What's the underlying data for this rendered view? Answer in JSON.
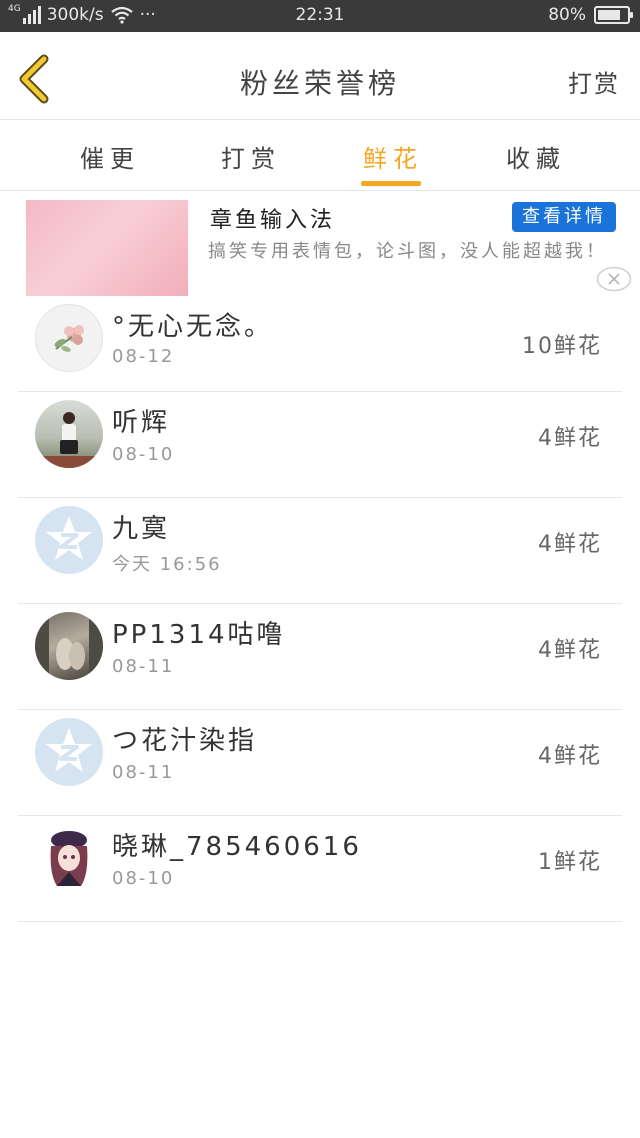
{
  "status_bar": {
    "network": "4G",
    "speed": "300k/s",
    "dots": "···",
    "time": "22:31",
    "battery": "80%",
    "battery_level": 0.8
  },
  "header": {
    "title": "粉丝荣誉榜",
    "action": "打赏"
  },
  "tabs": [
    {
      "label": "催更",
      "active": false
    },
    {
      "label": "打赏",
      "active": false
    },
    {
      "label": "鲜花",
      "active": true
    },
    {
      "label": "收藏",
      "active": false
    }
  ],
  "colors": {
    "accent": "#f5a623",
    "ad_button": "#1a73d9",
    "status_bar": "#3a3a3a"
  },
  "ad": {
    "title": "章鱼输入法",
    "button": "查看详情",
    "description": "搞笑专用表情包，论斗图，没人能超越我！"
  },
  "fans": [
    {
      "name": "°无心无念。",
      "date": "08-12",
      "amount": "10鲜花",
      "avatar": "flower-avatar"
    },
    {
      "name": "听辉",
      "date": "08-10",
      "amount": "4鲜花",
      "avatar": "photo-avatar"
    },
    {
      "name": "九寞",
      "date": "今天 16:56",
      "amount": "4鲜花",
      "avatar": "default-qq-avatar"
    },
    {
      "name": "PP1314咕噜",
      "date": "08-11",
      "amount": "4鲜花",
      "avatar": "photo-avatar"
    },
    {
      "name": "つ花汁染指",
      "date": "08-11",
      "amount": "4鲜花",
      "avatar": "default-qq-avatar"
    },
    {
      "name": "晓琳_785460616",
      "date": "08-10",
      "amount": "1鲜花",
      "avatar": "anime-avatar"
    }
  ]
}
